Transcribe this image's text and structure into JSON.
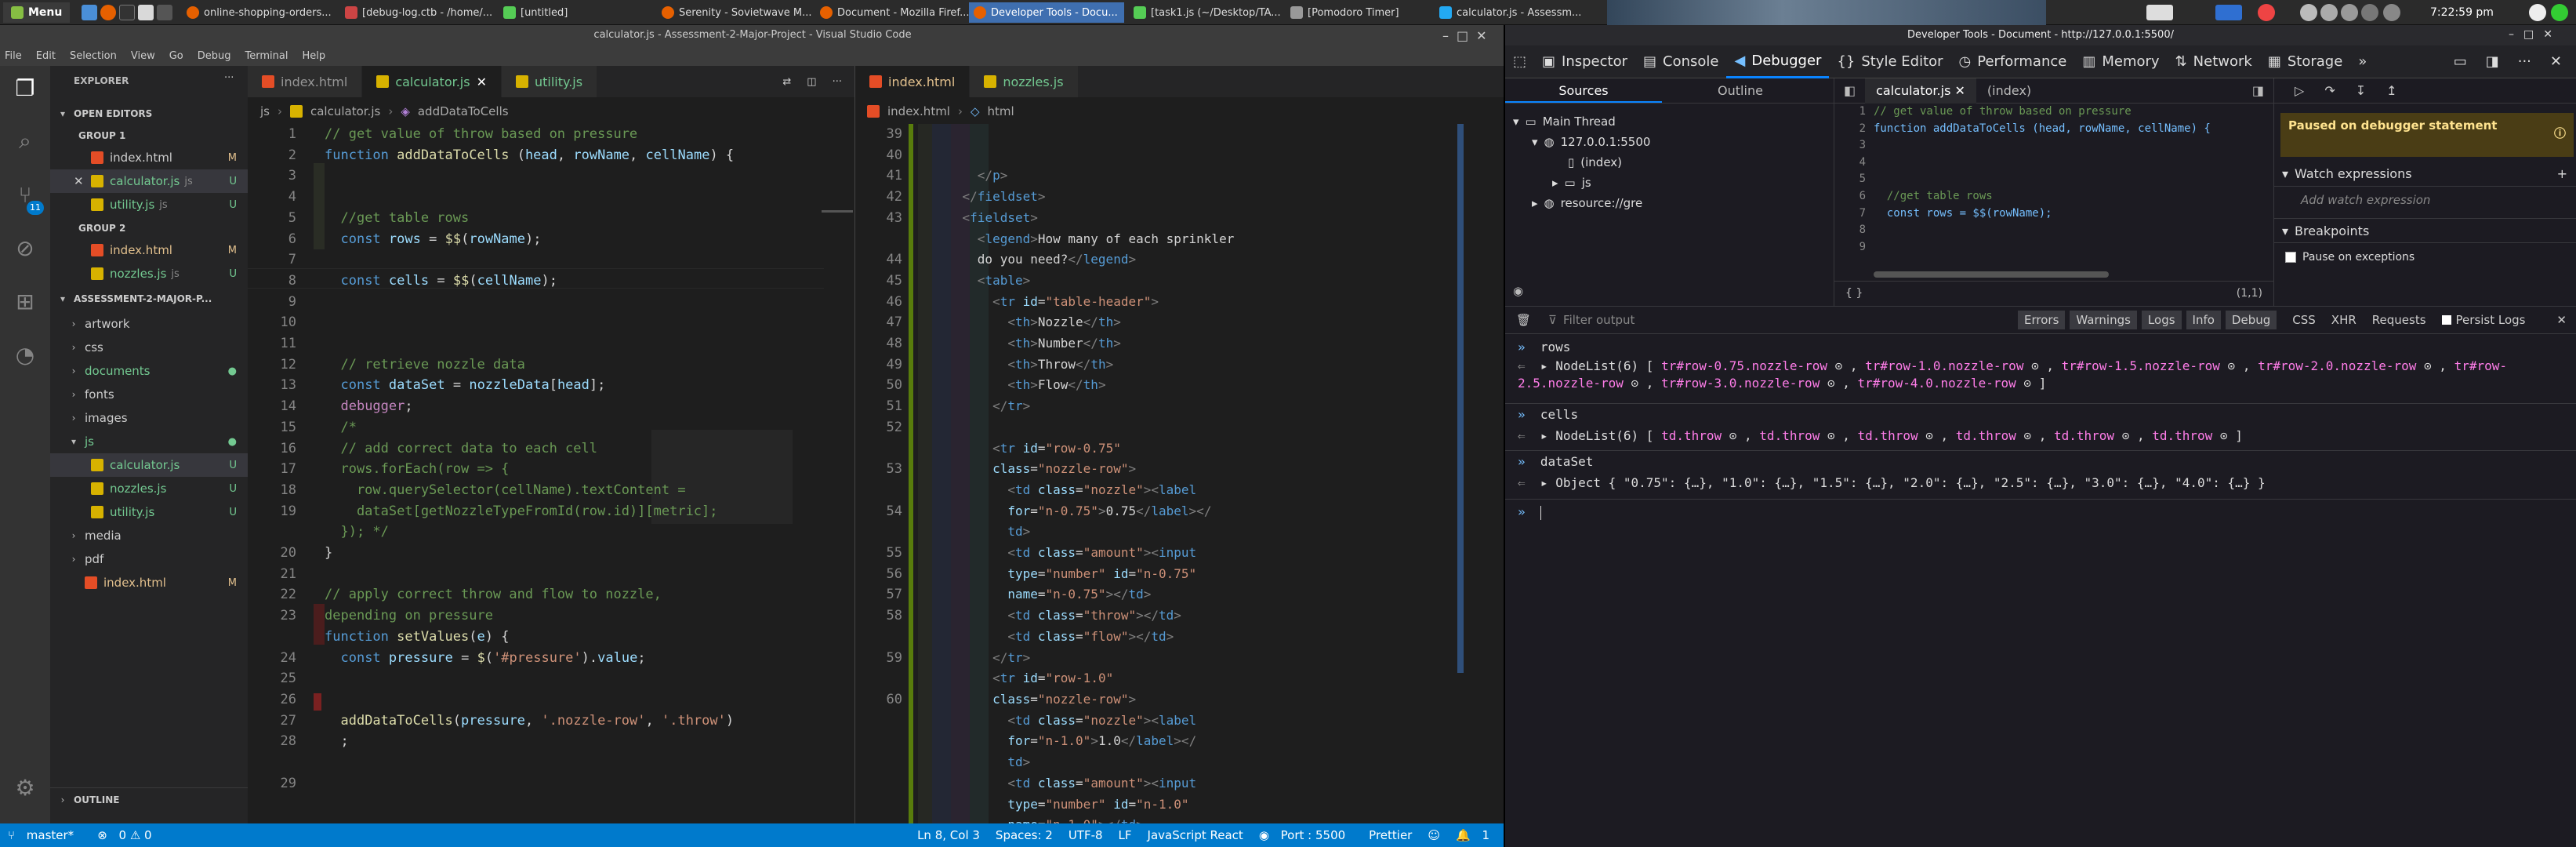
{
  "taskbar": {
    "menu_label": "Menu",
    "windows": [
      {
        "label": "online-shopping-orders..."
      },
      {
        "label": "[debug-log.ctb - /home/..."
      },
      {
        "label": "[untitled]"
      },
      {
        "label": "Serenity - Sovietwave M..."
      },
      {
        "label": "Document - Mozilla Firef..."
      },
      {
        "label": "Developer Tools - Docu..."
      },
      {
        "label": "[task1.js (~/Desktop/TA..."
      },
      {
        "label": "[Pomodoro Timer]"
      },
      {
        "label": "calculator.js - Assessm..."
      }
    ],
    "clock": "7:22:59 pm"
  },
  "vscode": {
    "title": "calculator.js - Assessment-2-Major-Project - Visual Studio Code",
    "menu": [
      "File",
      "Edit",
      "Selection",
      "View",
      "Go",
      "Debug",
      "Terminal",
      "Help"
    ],
    "activity_badge": "11",
    "sidebar": {
      "title": "EXPLORER",
      "open_editors": "OPEN EDITORS",
      "group1": "GROUP 1",
      "group2": "GROUP 2",
      "g1_files": [
        {
          "name": "index.html",
          "status": "M"
        },
        {
          "name": "calculator.js",
          "path": "js",
          "status": "U"
        },
        {
          "name": "utility.js",
          "path": "js",
          "status": "U"
        }
      ],
      "g2_files": [
        {
          "name": "index.html",
          "status": "M"
        },
        {
          "name": "nozzles.js",
          "path": "js",
          "status": "U"
        }
      ],
      "project": "ASSESSMENT-2-MAJOR-P...",
      "tree": [
        {
          "name": "artwork"
        },
        {
          "name": "css"
        },
        {
          "name": "documents"
        },
        {
          "name": "fonts"
        },
        {
          "name": "images"
        },
        {
          "name": "js"
        },
        {
          "name": "calculator.js",
          "status": "U"
        },
        {
          "name": "nozzles.js",
          "status": "U"
        },
        {
          "name": "utility.js",
          "status": "U"
        },
        {
          "name": "media"
        },
        {
          "name": "pdf"
        },
        {
          "name": "index.html",
          "status": "M"
        }
      ],
      "outline": "OUTLINE"
    },
    "editor1": {
      "tabs": [
        "index.html",
        "calculator.js",
        "utility.js"
      ],
      "breadcrumb": [
        "js",
        "calculator.js",
        "addDataToCells"
      ]
    },
    "editor2": {
      "tabs": [
        "index.html",
        "nozzles.js"
      ],
      "breadcrumb": [
        "index.html",
        "html"
      ]
    },
    "status": {
      "branch": "master*",
      "problems": "0 ⚠ 0",
      "position": "Ln 8, Col 3",
      "spaces": "Spaces: 2",
      "encoding": "UTF-8",
      "eol": "LF",
      "language": "JavaScript React",
      "port": "Port : 5500",
      "formatter": "Prettier",
      "notifications": "1"
    }
  },
  "devtools": {
    "title": "Developer Tools - Document - http://127.0.0.1:5500/",
    "tools": [
      "Inspector",
      "Console",
      "Debugger",
      "Style Editor",
      "Performance",
      "Memory",
      "Network",
      "Storage"
    ],
    "sources_tab": "Sources",
    "outline_tab": "Outline",
    "tree": [
      "Main Thread",
      "127.0.0.1:5500",
      "(index)",
      "js",
      "resource://gre"
    ],
    "file_tabs": [
      "calculator.js",
      "(index)"
    ],
    "code_lines": [
      "// get value of throw based on pressure",
      "function addDataToCells (head, rowName, cellName) {",
      "",
      "",
      "",
      "  //get table rows",
      "  const rows = $$(rowName);",
      "",
      ""
    ],
    "cursor_pos": "(1,1)",
    "paused": "Paused on debugger statement",
    "watch": "Watch expressions",
    "add_watch": "Add watch expression",
    "breakpoints": "Breakpoints",
    "pause_exc": "Pause on exceptions",
    "console": {
      "filter_placeholder": "Filter output",
      "filters": [
        "Errors",
        "Warnings",
        "Logs",
        "Info",
        "Debug",
        "CSS",
        "XHR",
        "Requests"
      ],
      "persist": "Persist Logs",
      "entries": [
        {
          "input": "rows",
          "out_prefix": "NodeList(6) [",
          "items": [
            "tr#row-0.75.nozzle-row",
            "tr#row-1.0.nozzle-row",
            "tr#row-1.5.nozzle-row",
            "tr#row-2.0.nozzle-row",
            "tr#row-2.5.nozzle-row",
            "tr#row-3.0.nozzle-row",
            "tr#row-4.0.nozzle-row"
          ]
        },
        {
          "input": "cells",
          "out_prefix": "NodeList(6) [",
          "items": [
            "td.throw",
            "td.throw",
            "td.throw",
            "td.throw",
            "td.throw",
            "td.throw"
          ]
        },
        {
          "input": "dataSet",
          "out": "Object { \"0.75\": {…}, \"1.0\": {…}, \"1.5\": {…}, \"2.0\": {…}, \"2.5\": {…}, \"3.0\": {…}, \"4.0\": {…} }"
        }
      ]
    }
  }
}
